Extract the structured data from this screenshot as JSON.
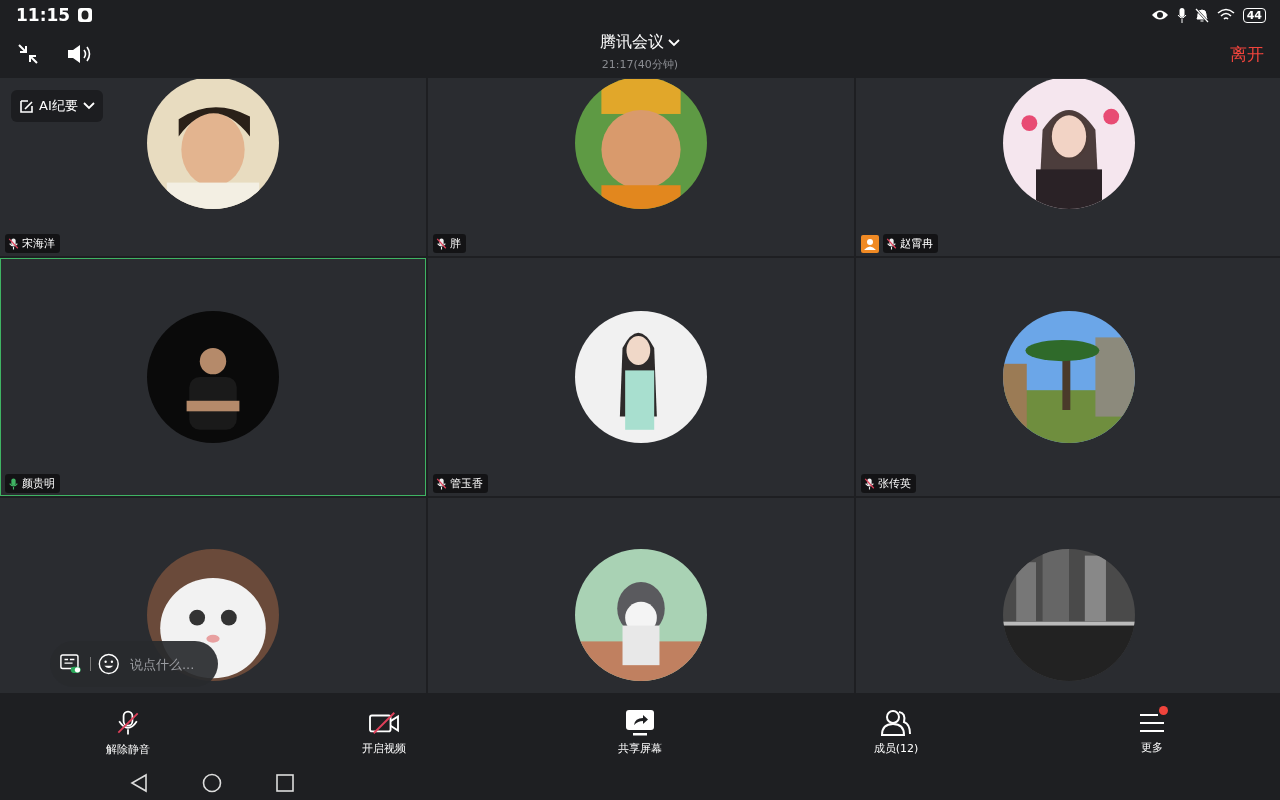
{
  "status_bar": {
    "time": "11:15",
    "battery": "44"
  },
  "header": {
    "title": "腾讯会议",
    "subtitle": "21:17(40分钟)",
    "leave": "离开"
  },
  "ai_button": {
    "label": "AI纪要"
  },
  "tiles": [
    {
      "name": "宋海洋",
      "speaking": false,
      "host": false,
      "avatar": {
        "kind": "picture"
      }
    },
    {
      "name": "胖",
      "speaking": false,
      "host": false,
      "avatar": {
        "kind": "picture"
      }
    },
    {
      "name": "赵霄冉",
      "speaking": false,
      "host": true,
      "avatar": {
        "kind": "picture"
      }
    },
    {
      "name": "颜贵明",
      "speaking": true,
      "host": false,
      "avatar": {
        "kind": "picture"
      }
    },
    {
      "name": "管玉香",
      "speaking": false,
      "host": false,
      "avatar": {
        "kind": "picture"
      }
    },
    {
      "name": "张传英",
      "speaking": false,
      "host": false,
      "avatar": {
        "kind": "picture"
      }
    },
    {
      "avatar": {
        "kind": "picture"
      }
    },
    {
      "avatar": {
        "kind": "picture"
      }
    },
    {
      "avatar": {
        "kind": "picture"
      }
    }
  ],
  "chat": {
    "placeholder": "说点什么..."
  },
  "toolbar": [
    {
      "kind": "mic",
      "label": "解除静音",
      "crossed": true,
      "dot": false
    },
    {
      "kind": "video",
      "label": "开启视频",
      "crossed": true,
      "dot": false
    },
    {
      "kind": "share",
      "label": "共享屏幕",
      "crossed": false,
      "dot": false
    },
    {
      "kind": "members",
      "label": "成员(12)",
      "crossed": false,
      "dot": false
    },
    {
      "kind": "more",
      "label": "更多",
      "crossed": false,
      "dot": true
    }
  ]
}
